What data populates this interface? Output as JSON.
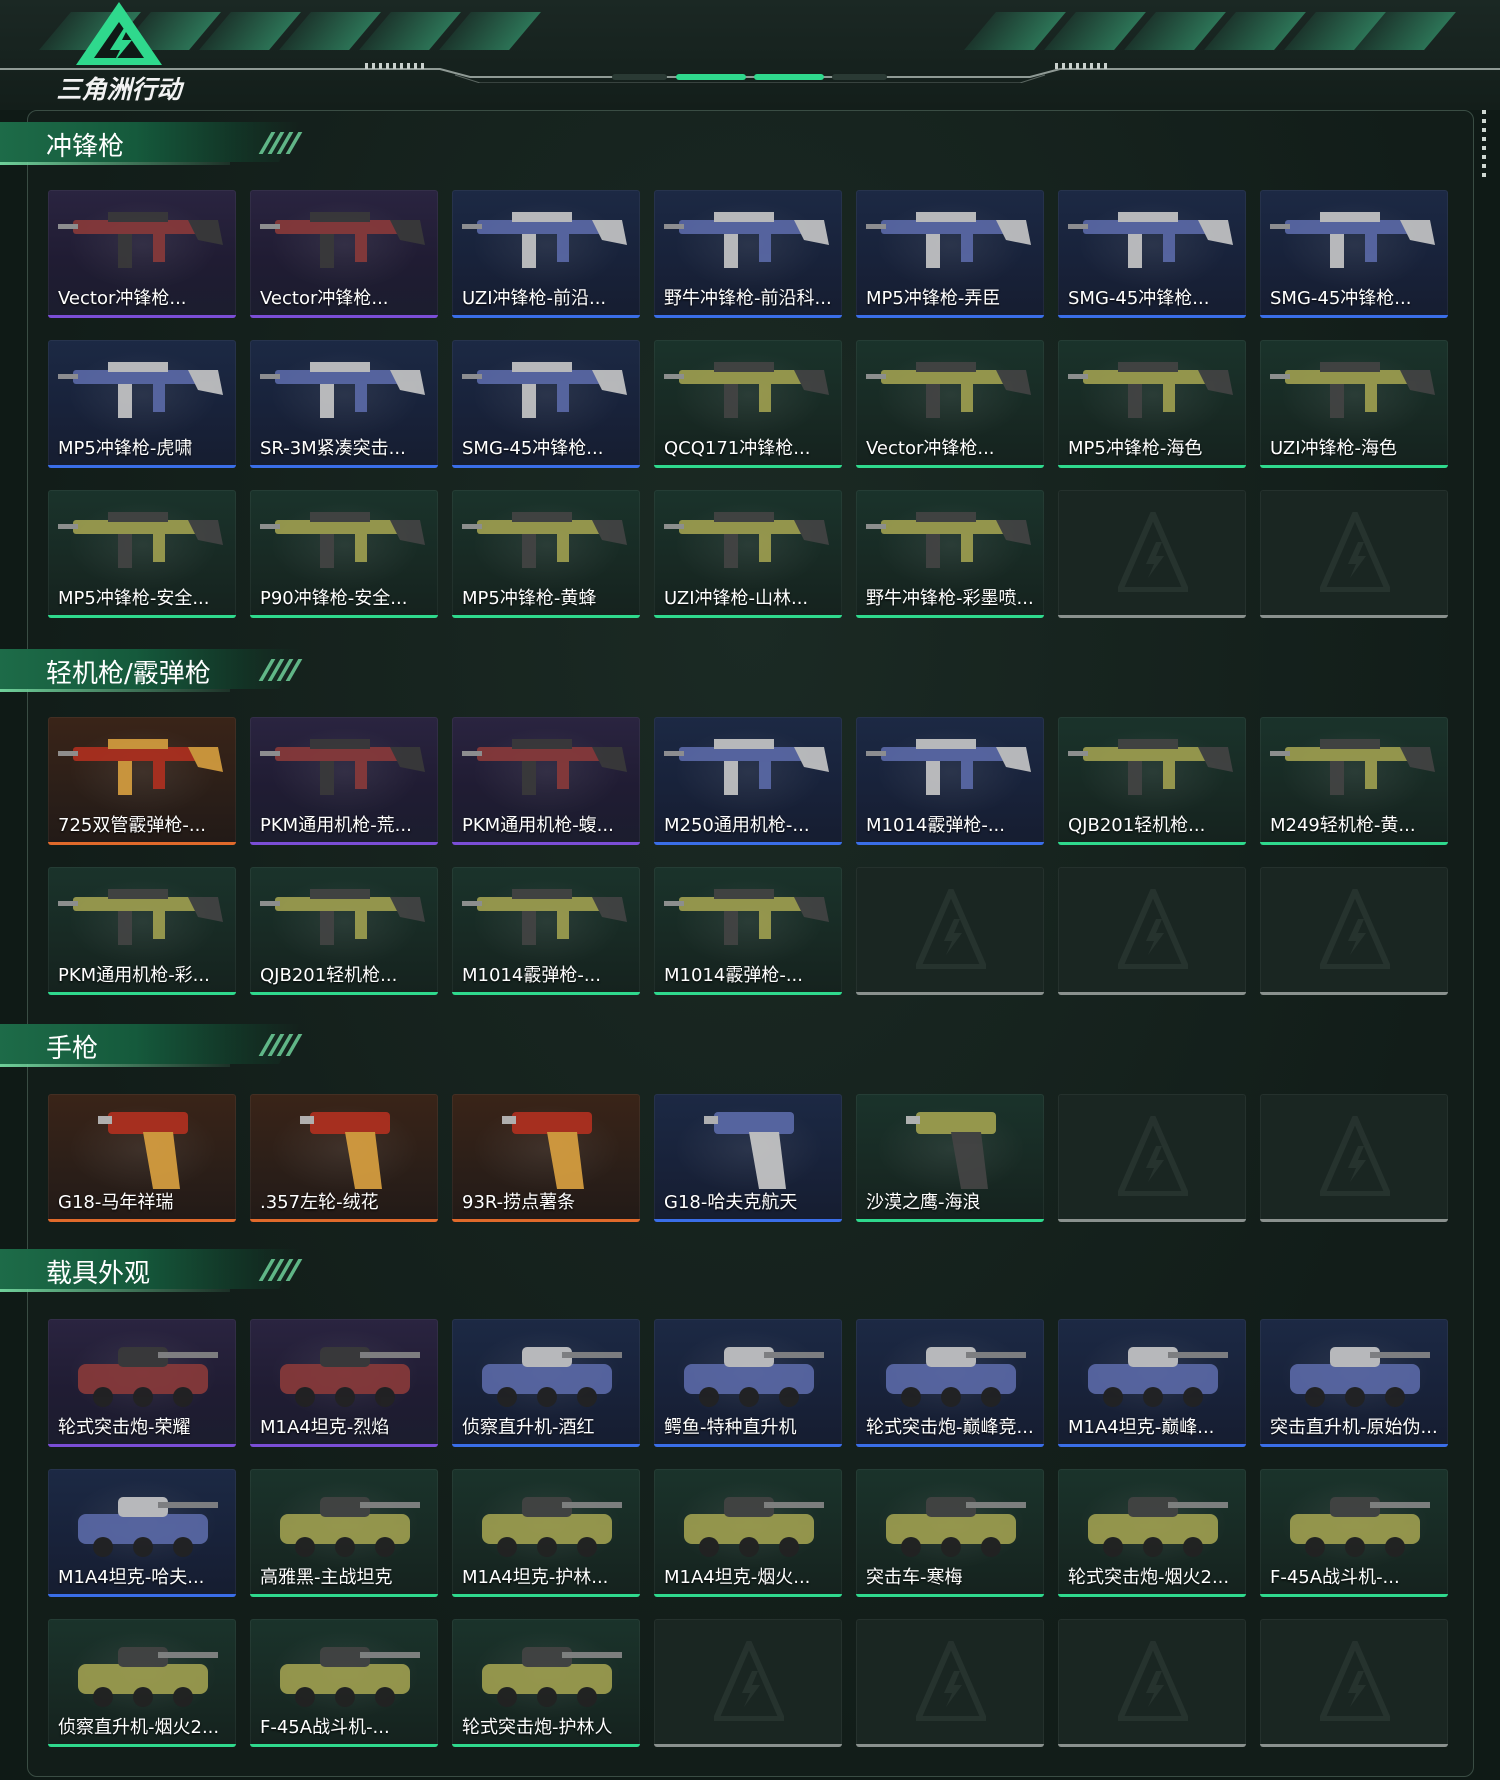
{
  "app": {
    "logo_text": "三角洲行动"
  },
  "colors": {
    "purple": "#7b4ed6",
    "blue": "#3a6ee8",
    "green": "#2fd98d",
    "orange": "#e06a2b",
    "empty": "#8a918e",
    "accent": "#1d6b48"
  },
  "sections": [
    {
      "title": "冲锋枪",
      "items": [
        {
          "name": "Vector冲锋枪...",
          "rarity": "purple"
        },
        {
          "name": "Vector冲锋枪...",
          "rarity": "purple"
        },
        {
          "name": "UZI冲锋枪-前沿...",
          "rarity": "blue"
        },
        {
          "name": "野牛冲锋枪-前沿科...",
          "rarity": "blue"
        },
        {
          "name": "MP5冲锋枪-弄臣",
          "rarity": "blue"
        },
        {
          "name": "SMG-45冲锋枪...",
          "rarity": "blue"
        },
        {
          "name": "SMG-45冲锋枪...",
          "rarity": "blue"
        },
        {
          "name": "MP5冲锋枪-虎啸",
          "rarity": "blue"
        },
        {
          "name": "SR-3M紧凑突击...",
          "rarity": "blue"
        },
        {
          "name": "SMG-45冲锋枪...",
          "rarity": "blue"
        },
        {
          "name": "QCQ171冲锋枪...",
          "rarity": "green"
        },
        {
          "name": "Vector冲锋枪...",
          "rarity": "green"
        },
        {
          "name": "MP5冲锋枪-海色",
          "rarity": "green"
        },
        {
          "name": "UZI冲锋枪-海色",
          "rarity": "green"
        },
        {
          "name": "MP5冲锋枪-安全...",
          "rarity": "green"
        },
        {
          "name": "P90冲锋枪-安全...",
          "rarity": "green"
        },
        {
          "name": "MP5冲锋枪-黄蜂",
          "rarity": "green"
        },
        {
          "name": "UZI冲锋枪-山林...",
          "rarity": "green"
        },
        {
          "name": "野牛冲锋枪-彩墨喷...",
          "rarity": "green"
        },
        {
          "name": "",
          "rarity": "empty"
        },
        {
          "name": "",
          "rarity": "empty"
        }
      ]
    },
    {
      "title": "轻机枪/霰弹枪",
      "items": [
        {
          "name": "725双管霰弹枪-...",
          "rarity": "orange"
        },
        {
          "name": "PKM通用机枪-荒...",
          "rarity": "purple"
        },
        {
          "name": "PKM通用机枪-蝮...",
          "rarity": "purple"
        },
        {
          "name": "M250通用机枪-...",
          "rarity": "blue"
        },
        {
          "name": "M1014霰弹枪-...",
          "rarity": "blue"
        },
        {
          "name": "QJB201轻机枪...",
          "rarity": "green"
        },
        {
          "name": "M249轻机枪-黄...",
          "rarity": "green"
        },
        {
          "name": "PKM通用机枪-彩...",
          "rarity": "green"
        },
        {
          "name": "QJB201轻机枪...",
          "rarity": "green"
        },
        {
          "name": "M1014霰弹枪-...",
          "rarity": "green"
        },
        {
          "name": "M1014霰弹枪-...",
          "rarity": "green"
        },
        {
          "name": "",
          "rarity": "empty"
        },
        {
          "name": "",
          "rarity": "empty"
        },
        {
          "name": "",
          "rarity": "empty"
        }
      ]
    },
    {
      "title": "手枪",
      "items": [
        {
          "name": "G18-马年祥瑞",
          "rarity": "orange"
        },
        {
          "name": ".357左轮-绒花",
          "rarity": "orange"
        },
        {
          "name": "93R-捞点薯条",
          "rarity": "orange"
        },
        {
          "name": "G18-哈夫克航天",
          "rarity": "blue"
        },
        {
          "name": "沙漠之鹰-海浪",
          "rarity": "green"
        },
        {
          "name": "",
          "rarity": "empty"
        },
        {
          "name": "",
          "rarity": "empty"
        }
      ]
    },
    {
      "title": "载具外观",
      "items": [
        {
          "name": "轮式突击炮-荣耀",
          "rarity": "purple"
        },
        {
          "name": "M1A4坦克-烈焰",
          "rarity": "purple"
        },
        {
          "name": "侦察直升机-酒红",
          "rarity": "blue"
        },
        {
          "name": "鳄鱼-特种直升机",
          "rarity": "blue"
        },
        {
          "name": "轮式突击炮-巅峰竞...",
          "rarity": "blue"
        },
        {
          "name": "M1A4坦克-巅峰...",
          "rarity": "blue"
        },
        {
          "name": "突击直升机-原始伪...",
          "rarity": "blue"
        },
        {
          "name": "M1A4坦克-哈夫...",
          "rarity": "blue"
        },
        {
          "name": "高雅黑-主战坦克",
          "rarity": "green"
        },
        {
          "name": "M1A4坦克-护林...",
          "rarity": "green"
        },
        {
          "name": "M1A4坦克-烟火...",
          "rarity": "green"
        },
        {
          "name": "突击车-寒梅",
          "rarity": "green"
        },
        {
          "name": "轮式突击炮-烟火2...",
          "rarity": "green"
        },
        {
          "name": "F-45A战斗机-...",
          "rarity": "green"
        },
        {
          "name": "侦察直升机-烟火2...",
          "rarity": "green"
        },
        {
          "name": "F-45A战斗机-...",
          "rarity": "green"
        },
        {
          "name": "轮式突击炮-护林人",
          "rarity": "green"
        },
        {
          "name": "",
          "rarity": "empty"
        },
        {
          "name": "",
          "rarity": "empty"
        },
        {
          "name": "",
          "rarity": "empty"
        },
        {
          "name": "",
          "rarity": "empty"
        }
      ]
    }
  ]
}
